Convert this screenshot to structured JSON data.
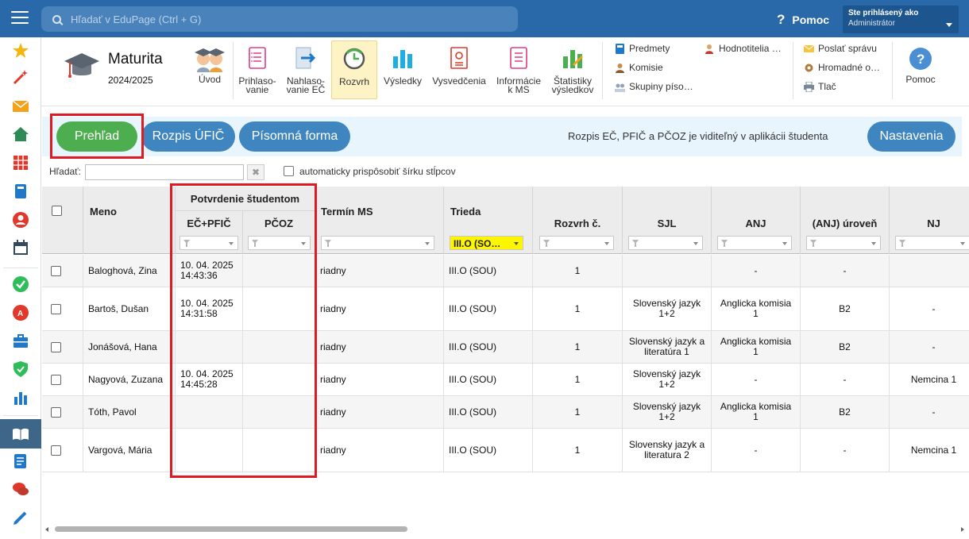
{
  "topbar": {
    "search_placeholder": "Hľadať v EduPage (Ctrl + G)",
    "help_label": "Pomoc",
    "user_line1": "Ste prihlásený ako",
    "user_line2": "Administrátor"
  },
  "sidebar_icons": [
    "star-icon",
    "magic-wand-icon",
    "mail-icon",
    "home-icon",
    "timetable-icon",
    "book-icon",
    "user-icon",
    "calendar-icon",
    "check-icon",
    "grade-icon",
    "briefcase-icon",
    "shield-icon",
    "chart-icon",
    "open-book-icon",
    "notes-icon",
    "chat-icon",
    "pen-icon"
  ],
  "module": {
    "title": "Maturita",
    "year": "2024/2025",
    "buttons": [
      {
        "label": "Úvod"
      },
      {
        "label": "Prihlaso-\nvanie"
      },
      {
        "label": "Nahlaso-\nvanie EČ"
      },
      {
        "label": "Rozvrh"
      },
      {
        "label": "Výsledky"
      },
      {
        "label": "Vysvedčenia"
      },
      {
        "label": "Informácie\nk MS"
      },
      {
        "label": "Štatistiky\nvýsledkov"
      }
    ],
    "links": {
      "predmety": "Predmety",
      "komisie": "Komisie",
      "skupiny": "Skupiny píso…",
      "hodnotitelia": "Hodnotitelia …",
      "poslat": "Poslať správu",
      "hromadne": "Hromadné o…",
      "tlac": "Tlač"
    },
    "help": "Pomoc"
  },
  "tabs": {
    "prehlad": "Prehľad",
    "rozpis": "Rozpis ÚFIČ",
    "pisomna": "Písomná forma",
    "info": "Rozpis EČ, PFIČ a PČOZ je viditeľný v aplikácii študenta",
    "nastavenia": "Nastavenia"
  },
  "filter": {
    "label": "Hľadať:",
    "value": "",
    "auto_width_label": "automaticky prispôsobiť šírku stĺpcov",
    "clear_symbol": "✖"
  },
  "table": {
    "headers": {
      "meno": "Meno",
      "potvrdenie": "Potvrdenie študentom",
      "ec_pfic": "EČ+PFIČ",
      "pcoz": "PČOZ",
      "termin": "Termín MS",
      "trieda": "Trieda",
      "rozvrh": "Rozvrh č.",
      "sjl": "SJL",
      "anj": "ANJ",
      "anj_uroven": "(ANJ) úroveň",
      "nj": "NJ"
    },
    "trieda_filter_value": "III.O (SO…",
    "rows": [
      {
        "meno": "Baloghová, Zina",
        "ec_date": "10. 04. 2025",
        "ec_time": "14:43:36",
        "pcoz": "",
        "termin": "riadny",
        "trieda": "III.O (SOU)",
        "rozvrh": "1",
        "sjl1": "",
        "sjl2": "",
        "anj1": "-",
        "anj2": "",
        "uroven": "-",
        "nj": ""
      },
      {
        "meno": "Bartoš, Dušan",
        "ec_date": "10. 04. 2025",
        "ec_time": "14:31:58",
        "pcoz": "",
        "termin": "riadny",
        "trieda": "III.O (SOU)",
        "rozvrh": "1",
        "sjl1": "Slovenský jazyk",
        "sjl2": "1+2",
        "anj1": "Anglicka komisia",
        "anj2": "1",
        "uroven": "B2",
        "nj": "-"
      },
      {
        "meno": "Jonášová, Hana",
        "ec_date": "",
        "ec_time": "",
        "pcoz": "",
        "termin": "riadny",
        "trieda": "III.O (SOU)",
        "rozvrh": "1",
        "sjl1": "Slovenský jazyk a",
        "sjl2": "literatúra 1",
        "anj1": "Anglicka komisia",
        "anj2": "1",
        "uroven": "B2",
        "nj": "-"
      },
      {
        "meno": "Nagyová, Zuzana",
        "ec_date": "10. 04. 2025",
        "ec_time": "14:45:28",
        "pcoz": "",
        "termin": "riadny",
        "trieda": "III.O (SOU)",
        "rozvrh": "1",
        "sjl1": "Slovenský jazyk",
        "sjl2": "1+2",
        "anj1": "-",
        "anj2": "",
        "uroven": "-",
        "nj": "Nemcina 1"
      },
      {
        "meno": "Tóth, Pavol",
        "ec_date": "",
        "ec_time": "",
        "pcoz": "",
        "termin": "riadny",
        "trieda": "III.O (SOU)",
        "rozvrh": "1",
        "sjl1": "Slovenský jazyk",
        "sjl2": "1+2",
        "anj1": "Anglicka komisia",
        "anj2": "1",
        "uroven": "B2",
        "nj": "-"
      },
      {
        "meno": "Vargová, Mária",
        "ec_date": "",
        "ec_time": "",
        "pcoz": "",
        "termin": "riadny",
        "trieda": "III.O (SOU)",
        "rozvrh": "1",
        "sjl1": "Slovensky jazyk a",
        "sjl2": "literatura 2",
        "anj1": "-",
        "anj2": "",
        "uroven": "-",
        "nj": "Nemcina 1"
      }
    ]
  },
  "colors": {
    "topbar": "#2a69a9",
    "pill_blue": "#3f86c0",
    "pill_green": "#4dae4f",
    "highlight_red": "#e01a22",
    "filter_yellow": "#fef600"
  }
}
